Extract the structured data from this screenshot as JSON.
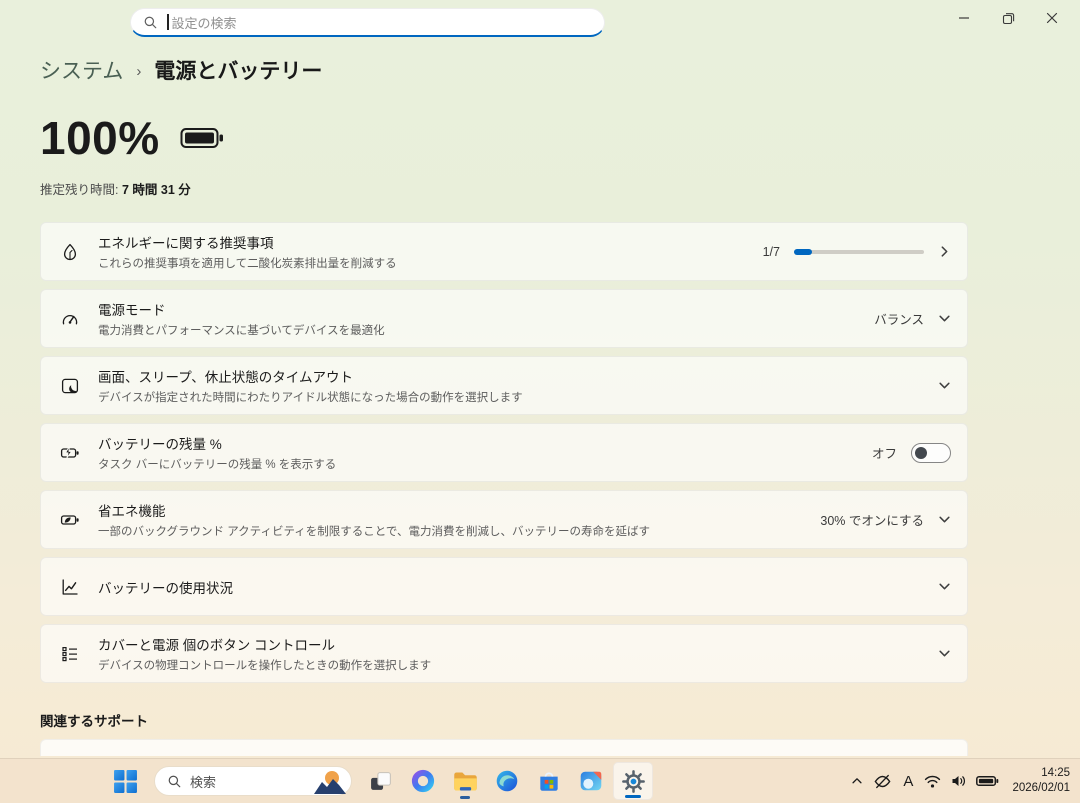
{
  "window": {
    "search_placeholder": "設定の検索"
  },
  "breadcrumb": {
    "parent": "システム",
    "separator": "›",
    "current": "電源とバッテリー"
  },
  "battery": {
    "percent": "100%",
    "estimate_label": "推定残り時間:",
    "estimate_value": "7 時間 31 分"
  },
  "cards": [
    {
      "icon": "energy-leaf-icon",
      "title": "エネルギーに関する推奨事項",
      "subtitle": "これらの推奨事項を適用して二酸化炭素排出量を削減する",
      "progress": {
        "label": "1/7",
        "percent": 14
      }
    },
    {
      "icon": "power-mode-gauge-icon",
      "title": "電源モード",
      "subtitle": "電力消費とパフォーマンスに基づいてデバイスを最適化",
      "value": "バランス"
    },
    {
      "icon": "screen-sleep-icon",
      "title": "画面、スリープ、休止状態のタイムアウト",
      "subtitle": "デバイスが指定された時間にわたりアイドル状態になった場合の動作を選択します"
    },
    {
      "icon": "battery-percent-icon",
      "title": "バッテリーの残量 %",
      "subtitle": "タスク バーにバッテリーの残量 % を表示する",
      "toggle": {
        "label": "オフ",
        "state": "off"
      }
    },
    {
      "icon": "energy-saver-icon",
      "title": "省エネ機能",
      "subtitle": "一部のバックグラウンド アクティビティを制限することで、電力消費を削減し、バッテリーの寿命を延ばす",
      "value": "30% でオンにする"
    },
    {
      "icon": "battery-usage-chart-icon",
      "title": "バッテリーの使用状況",
      "subtitle": ""
    },
    {
      "icon": "lid-power-buttons-icon",
      "title": "カバーと電源 個のボタン コントロール",
      "subtitle": "デバイスの物理コントロールを操作したときの動作を選択します"
    }
  ],
  "related_heading": "関連するサポート",
  "taskbar": {
    "search_label": "検索",
    "ime_mode": "A",
    "clock": {
      "time": "14:25",
      "date": "2026/02/01"
    }
  },
  "colors": {
    "accent": "#0067c0",
    "bg_top": "#e9f0dc",
    "bg_bottom": "#f7ead2",
    "taskbar_bg": "#f3e3cd",
    "breadcrumb_parent": "#4a6054"
  }
}
